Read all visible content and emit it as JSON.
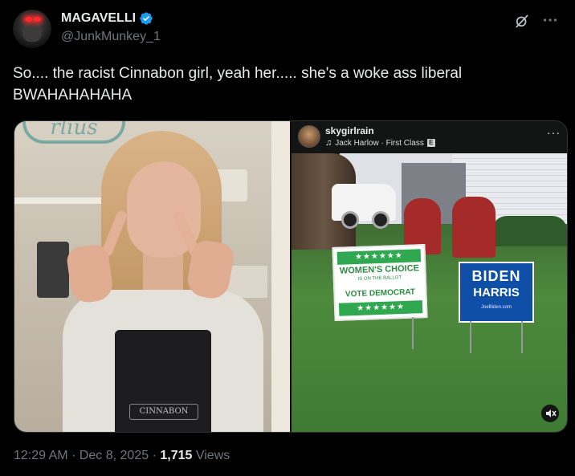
{
  "author": {
    "display_name": "MAGAVELLI",
    "handle": "@JunkMunkey_1",
    "verified": true,
    "verified_color": "#1d9bf0"
  },
  "header_icons": [
    "grok-icon",
    "more-options-icon"
  ],
  "tweet": {
    "line1": "So.... the racist Cinnabon girl, yeah her..... she's a woke ass liberal",
    "line2": "BWAHAHAHAHA"
  },
  "media": {
    "left_image": {
      "apron_text": "CINNABON",
      "logo_text": "rlius"
    },
    "right_image": {
      "ig_username": "skygirlrain",
      "ig_song": "Jack Harlow · First Class",
      "ig_explicit_badge": "E",
      "ig_more": "···",
      "green_sign": {
        "line1": "WOMEN'S CHOICE",
        "line2": "IS ON THE BALLOT",
        "line3": "VOTE DEMOCRAT",
        "stars": "★★★★★★"
      },
      "blue_sign": {
        "line1": "BIDEN",
        "line2": "HARRIS",
        "line3": "JoeBiden.com"
      }
    }
  },
  "meta": {
    "time": "12:29 AM",
    "date": "Dec 8, 2025",
    "views_count": "1,715",
    "views_label": "Views",
    "separator": "·"
  }
}
